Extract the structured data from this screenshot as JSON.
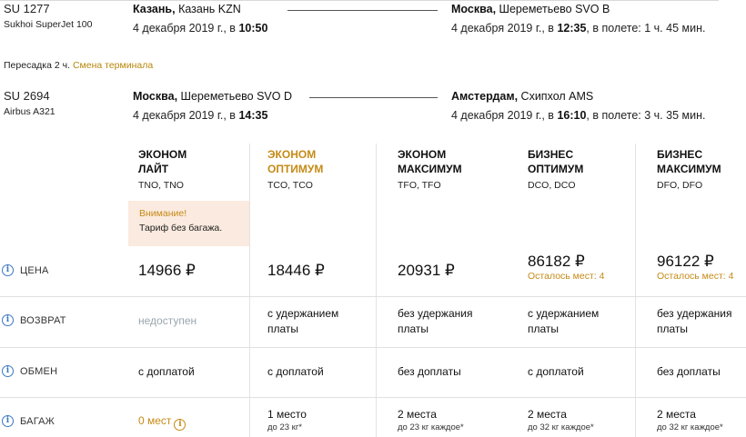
{
  "segments": [
    {
      "flight": "SU 1277",
      "aircraft": "Sukhoi SuperJet 100",
      "from_city": "Казань,",
      "from_airport": " Казань KZN",
      "dep_date": "4 декабря 2019 г., в",
      "dep_time": "10:50",
      "to_city": "Москва,",
      "to_airport": " Шереметьево SVO B",
      "arr_date": "4 декабря 2019 г., в",
      "arr_time": "12:35",
      "duration": ", в полете: 1 ч. 45 мин."
    },
    {
      "flight": "SU 2694",
      "aircraft": "Airbus A321",
      "from_city": "Москва,",
      "from_airport": " Шереметьево SVO D",
      "dep_date": "4 декабря 2019 г., в",
      "dep_time": "14:35",
      "to_city": "Амстердам,",
      "to_airport": " Схипхол AMS",
      "arr_date": "4 декабря 2019 г., в",
      "arr_time": "16:10",
      "duration": ", в полете: 3 ч. 35 мин."
    }
  ],
  "transfer": {
    "text": "Пересадка 2 ч.",
    "warning": "Смена терминала"
  },
  "fares": [
    {
      "name1": "ЭКОНОМ",
      "name2": "ЛАЙТ",
      "code": "TNO, TNO",
      "price": "14966 ₽",
      "seats": "",
      "refund": "недоступен",
      "exchange": "с доплатой",
      "baggage": "0 мест",
      "baggage_sub": ""
    },
    {
      "name1": "ЭКОНОМ",
      "name2": "ОПТИМУМ",
      "code": "TCO, TCO",
      "price": "18446 ₽",
      "seats": "",
      "refund": "с удержанием платы",
      "exchange": "с доплатой",
      "baggage": "1 место",
      "baggage_sub": "до 23 кг*"
    },
    {
      "name1": "ЭКОНОМ",
      "name2": "МАКСИМУМ",
      "code": "TFO, TFO",
      "price": "20931 ₽",
      "seats": "",
      "refund": "без удержания платы",
      "exchange": "без доплаты",
      "baggage": "2 места",
      "baggage_sub": "до 23 кг каждое*"
    },
    {
      "name1": "БИЗНЕС",
      "name2": "ОПТИМУМ",
      "code": "DCO, DCO",
      "price": "86182 ₽",
      "seats": "Осталось мест: 4",
      "refund": "с удержанием платы",
      "exchange": "с доплатой",
      "baggage": "2 места",
      "baggage_sub": "до 32 кг каждое*"
    },
    {
      "name1": "БИЗНЕС",
      "name2": "МАКСИМУМ",
      "code": "DFO, DFO",
      "price": "96122 ₽",
      "seats": "Осталось мест: 4",
      "refund": "без удержания платы",
      "exchange": "без доплаты",
      "baggage": "2 места",
      "baggage_sub": "до 32 кг каждое*"
    }
  ],
  "notice": {
    "title": "Внимание!",
    "text": "Тариф без багажа."
  },
  "rows": {
    "price": "ЦЕНА",
    "refund": "ВОЗВРАТ",
    "exchange": "ОБМЕН",
    "baggage": "БАГАЖ"
  },
  "icons": {
    "info": "info-circle-icon"
  },
  "colors": {
    "accent": "#c58a16",
    "info": "#3b78c2",
    "notice_bg": "#fbeadf",
    "muted": "#9aa5ad"
  }
}
